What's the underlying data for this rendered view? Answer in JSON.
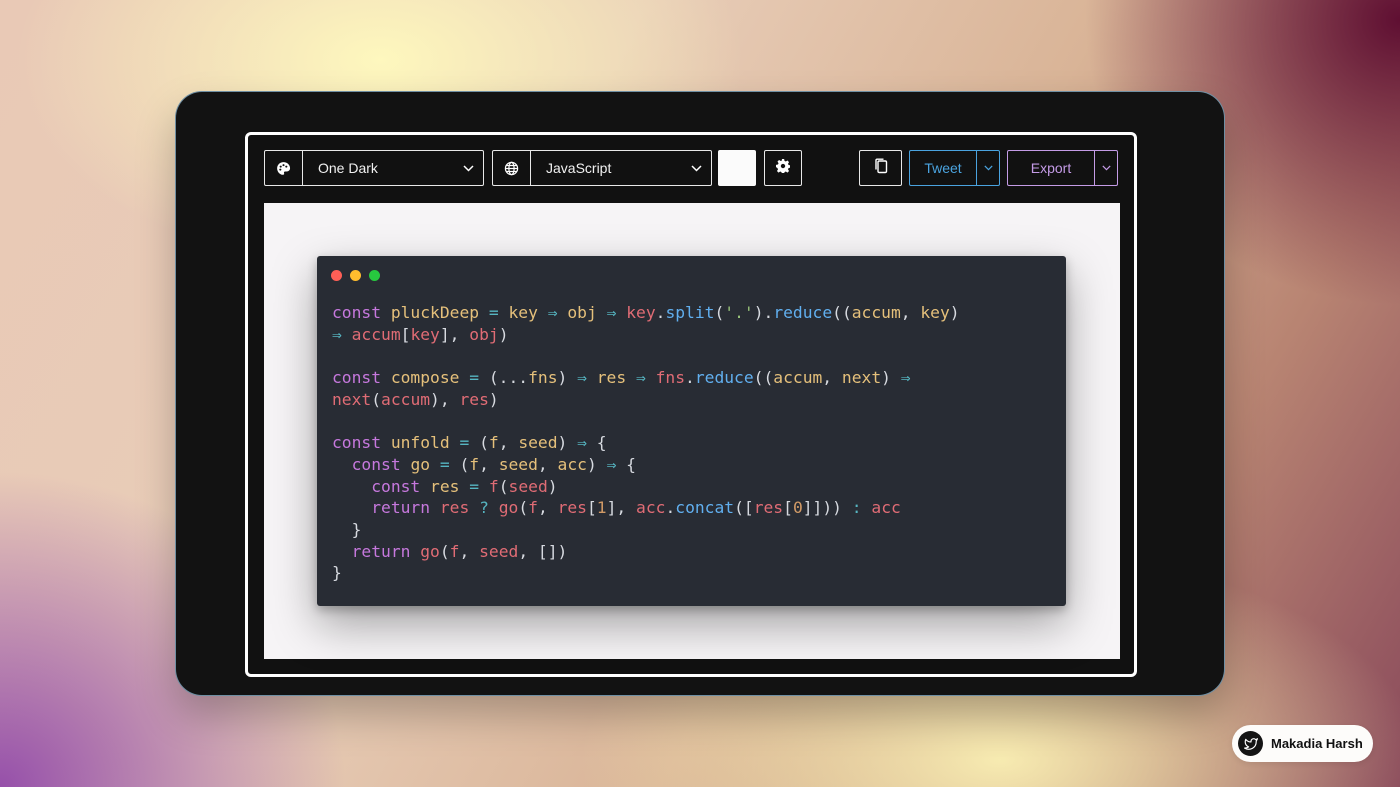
{
  "toolbar": {
    "theme_select": {
      "value": "One Dark",
      "icon": "palette-icon"
    },
    "language_select": {
      "value": "JavaScript",
      "icon": "globe-icon"
    },
    "background_color": "#fbfbfb",
    "settings_icon": "gear-icon",
    "copy_icon": "copy-icon",
    "tweet": {
      "label": "Tweet",
      "color": "#4aa3df"
    },
    "export": {
      "label": "Export",
      "color": "#c49be6"
    }
  },
  "editor": {
    "window_controls": {
      "close": "#ff5f56",
      "minimize": "#ffbd2e",
      "maximize": "#27c93f"
    },
    "theme_colors": {
      "background": "#282c34",
      "keyword": "#c678dd",
      "variable": "#e5c07b",
      "operator": "#56b6c2",
      "identifier": "#e06c75",
      "function": "#61afef",
      "number": "#d19a66",
      "string": "#98c379"
    },
    "code_lines": [
      [
        [
          "kw",
          "const"
        ],
        [
          "pl",
          " "
        ],
        [
          "vr",
          "pluckDeep"
        ],
        [
          "pl",
          " "
        ],
        [
          "ar",
          "="
        ],
        [
          "pl",
          " "
        ],
        [
          "vr",
          "key"
        ],
        [
          "pl",
          " "
        ],
        [
          "ar",
          "⇒"
        ],
        [
          "pl",
          " "
        ],
        [
          "vr",
          "obj"
        ],
        [
          "pl",
          " "
        ],
        [
          "ar",
          "⇒"
        ],
        [
          "pl",
          " "
        ],
        [
          "rd",
          "key"
        ],
        [
          "pl",
          "."
        ],
        [
          "fn",
          "split"
        ],
        [
          "pl",
          "("
        ],
        [
          "st",
          "'.'"
        ],
        [
          "pl",
          ")."
        ],
        [
          "fn",
          "reduce"
        ],
        [
          "pl",
          "(("
        ],
        [
          "vr",
          "accum"
        ],
        [
          "pl",
          ", "
        ],
        [
          "vr",
          "key"
        ],
        [
          "pl",
          ")"
        ]
      ],
      [
        [
          "ar",
          "⇒"
        ],
        [
          "pl",
          " "
        ],
        [
          "rd",
          "accum"
        ],
        [
          "pl",
          "["
        ],
        [
          "rd",
          "key"
        ],
        [
          "pl",
          "], "
        ],
        [
          "rd",
          "obj"
        ],
        [
          "pl",
          ")"
        ]
      ],
      [],
      [
        [
          "kw",
          "const"
        ],
        [
          "pl",
          " "
        ],
        [
          "vr",
          "compose"
        ],
        [
          "pl",
          " "
        ],
        [
          "ar",
          "="
        ],
        [
          "pl",
          " (..."
        ],
        [
          "vr",
          "fns"
        ],
        [
          "pl",
          ") "
        ],
        [
          "ar",
          "⇒"
        ],
        [
          "pl",
          " "
        ],
        [
          "vr",
          "res"
        ],
        [
          "pl",
          " "
        ],
        [
          "ar",
          "⇒"
        ],
        [
          "pl",
          " "
        ],
        [
          "rd",
          "fns"
        ],
        [
          "pl",
          "."
        ],
        [
          "fn",
          "reduce"
        ],
        [
          "pl",
          "(("
        ],
        [
          "vr",
          "accum"
        ],
        [
          "pl",
          ", "
        ],
        [
          "vr",
          "next"
        ],
        [
          "pl",
          ") "
        ],
        [
          "ar",
          "⇒"
        ]
      ],
      [
        [
          "rd",
          "next"
        ],
        [
          "pl",
          "("
        ],
        [
          "rd",
          "accum"
        ],
        [
          "pl",
          "), "
        ],
        [
          "rd",
          "res"
        ],
        [
          "pl",
          ")"
        ]
      ],
      [],
      [
        [
          "kw",
          "const"
        ],
        [
          "pl",
          " "
        ],
        [
          "vr",
          "unfold"
        ],
        [
          "pl",
          " "
        ],
        [
          "ar",
          "="
        ],
        [
          "pl",
          " ("
        ],
        [
          "vr",
          "f"
        ],
        [
          "pl",
          ", "
        ],
        [
          "vr",
          "seed"
        ],
        [
          "pl",
          ") "
        ],
        [
          "ar",
          "⇒"
        ],
        [
          "pl",
          " {"
        ]
      ],
      [
        [
          "pl",
          "  "
        ],
        [
          "kw",
          "const"
        ],
        [
          "pl",
          " "
        ],
        [
          "vr",
          "go"
        ],
        [
          "pl",
          " "
        ],
        [
          "ar",
          "="
        ],
        [
          "pl",
          " ("
        ],
        [
          "vr",
          "f"
        ],
        [
          "pl",
          ", "
        ],
        [
          "vr",
          "seed"
        ],
        [
          "pl",
          ", "
        ],
        [
          "vr",
          "acc"
        ],
        [
          "pl",
          ") "
        ],
        [
          "ar",
          "⇒"
        ],
        [
          "pl",
          " {"
        ]
      ],
      [
        [
          "pl",
          "    "
        ],
        [
          "kw",
          "const"
        ],
        [
          "pl",
          " "
        ],
        [
          "vr",
          "res"
        ],
        [
          "pl",
          " "
        ],
        [
          "ar",
          "="
        ],
        [
          "pl",
          " "
        ],
        [
          "rd",
          "f"
        ],
        [
          "pl",
          "("
        ],
        [
          "rd",
          "seed"
        ],
        [
          "pl",
          ")"
        ]
      ],
      [
        [
          "pl",
          "    "
        ],
        [
          "kw",
          "return"
        ],
        [
          "pl",
          " "
        ],
        [
          "rd",
          "res"
        ],
        [
          "pl",
          " "
        ],
        [
          "ar",
          "?"
        ],
        [
          "pl",
          " "
        ],
        [
          "rd",
          "go"
        ],
        [
          "pl",
          "("
        ],
        [
          "rd",
          "f"
        ],
        [
          "pl",
          ", "
        ],
        [
          "rd",
          "res"
        ],
        [
          "pl",
          "["
        ],
        [
          "nm",
          "1"
        ],
        [
          "pl",
          "], "
        ],
        [
          "rd",
          "acc"
        ],
        [
          "pl",
          "."
        ],
        [
          "fn",
          "concat"
        ],
        [
          "pl",
          "(["
        ],
        [
          "rd",
          "res"
        ],
        [
          "pl",
          "["
        ],
        [
          "nm",
          "0"
        ],
        [
          "pl",
          "]])) "
        ],
        [
          "ar",
          ":"
        ],
        [
          "pl",
          " "
        ],
        [
          "rd",
          "acc"
        ]
      ],
      [
        [
          "pl",
          "  }"
        ]
      ],
      [
        [
          "pl",
          "  "
        ],
        [
          "kw",
          "return"
        ],
        [
          "pl",
          " "
        ],
        [
          "rd",
          "go"
        ],
        [
          "pl",
          "("
        ],
        [
          "rd",
          "f"
        ],
        [
          "pl",
          ", "
        ],
        [
          "rd",
          "seed"
        ],
        [
          "pl",
          ", [])"
        ]
      ],
      [
        [
          "pl",
          "}"
        ]
      ]
    ]
  },
  "watermark": {
    "name": "Makadia Harsh",
    "icon": "twitter-bird-icon"
  }
}
